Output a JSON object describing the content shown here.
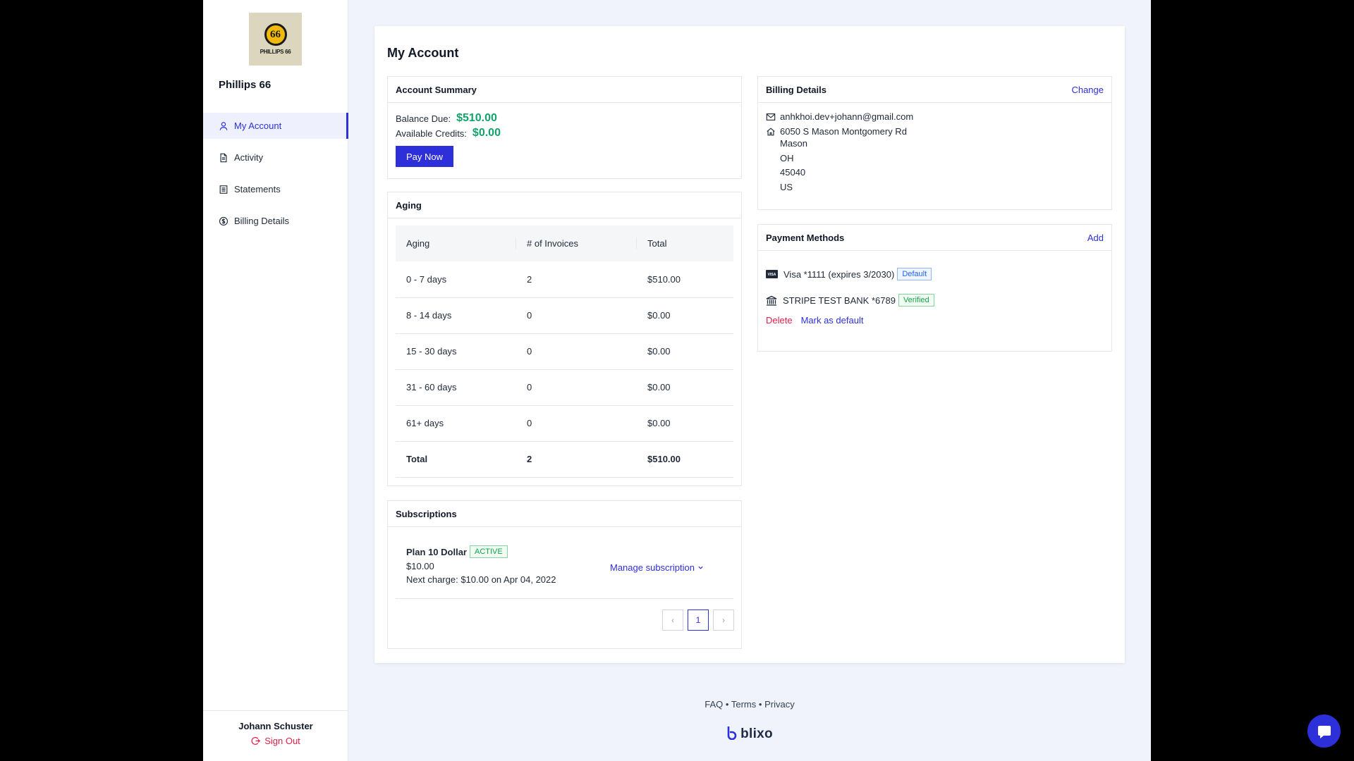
{
  "company": {
    "name": "Phillips 66",
    "logo_text": "PHILLIPS 66",
    "logo_mark": "66"
  },
  "nav": [
    {
      "label": "My Account",
      "icon": "user-icon",
      "active": true
    },
    {
      "label": "Activity",
      "icon": "document-icon",
      "active": false
    },
    {
      "label": "Statements",
      "icon": "list-icon",
      "active": false
    },
    {
      "label": "Billing Details",
      "icon": "dollar-circle-icon",
      "active": false
    }
  ],
  "user": {
    "name": "Johann Schuster",
    "signout": "Sign Out"
  },
  "page_title": "My Account",
  "summary": {
    "title": "Account Summary",
    "balance_label": "Balance Due:",
    "balance": "$510.00",
    "credits_label": "Available Credits:",
    "credits": "$0.00",
    "pay_button": "Pay Now"
  },
  "aging": {
    "title": "Aging",
    "headers": [
      "Aging",
      "# of Invoices",
      "Total"
    ],
    "rows": [
      [
        "0 - 7 days",
        "2",
        "$510.00"
      ],
      [
        "8 - 14 days",
        "0",
        "$0.00"
      ],
      [
        "15 - 30 days",
        "0",
        "$0.00"
      ],
      [
        "31 - 60 days",
        "0",
        "$0.00"
      ],
      [
        "61+ days",
        "0",
        "$0.00"
      ]
    ],
    "total": [
      "Total",
      "2",
      "$510.00"
    ]
  },
  "subscriptions": {
    "title": "Subscriptions",
    "plan": "Plan 10 Dollar",
    "status": "ACTIVE",
    "price": "$10.00",
    "next_charge": "Next charge: $10.00 on Apr 04, 2022",
    "manage": "Manage subscription",
    "page": "1",
    "prev": "‹",
    "next": "›"
  },
  "billing": {
    "title": "Billing Details",
    "change": "Change",
    "email": "anhkhoi.dev+johann@gmail.com",
    "address": [
      "6050 S Mason Montgomery Rd",
      "Mason",
      "OH",
      "45040",
      "US"
    ]
  },
  "payment": {
    "title": "Payment Methods",
    "add": "Add",
    "card": "Visa *1111 (expires 3/2030)",
    "card_badge": "Default",
    "bank": "STRIPE TEST BANK *6789",
    "bank_badge": "Verified",
    "delete": "Delete",
    "mark_default": "Mark as default"
  },
  "footer": {
    "faq": "FAQ",
    "terms": "Terms",
    "privacy": "Privacy",
    "sep": "•",
    "brand": "blixo"
  },
  "colors": {
    "accent": "#2d2fd8",
    "money": "#12a36a",
    "danger": "#e11d48"
  }
}
